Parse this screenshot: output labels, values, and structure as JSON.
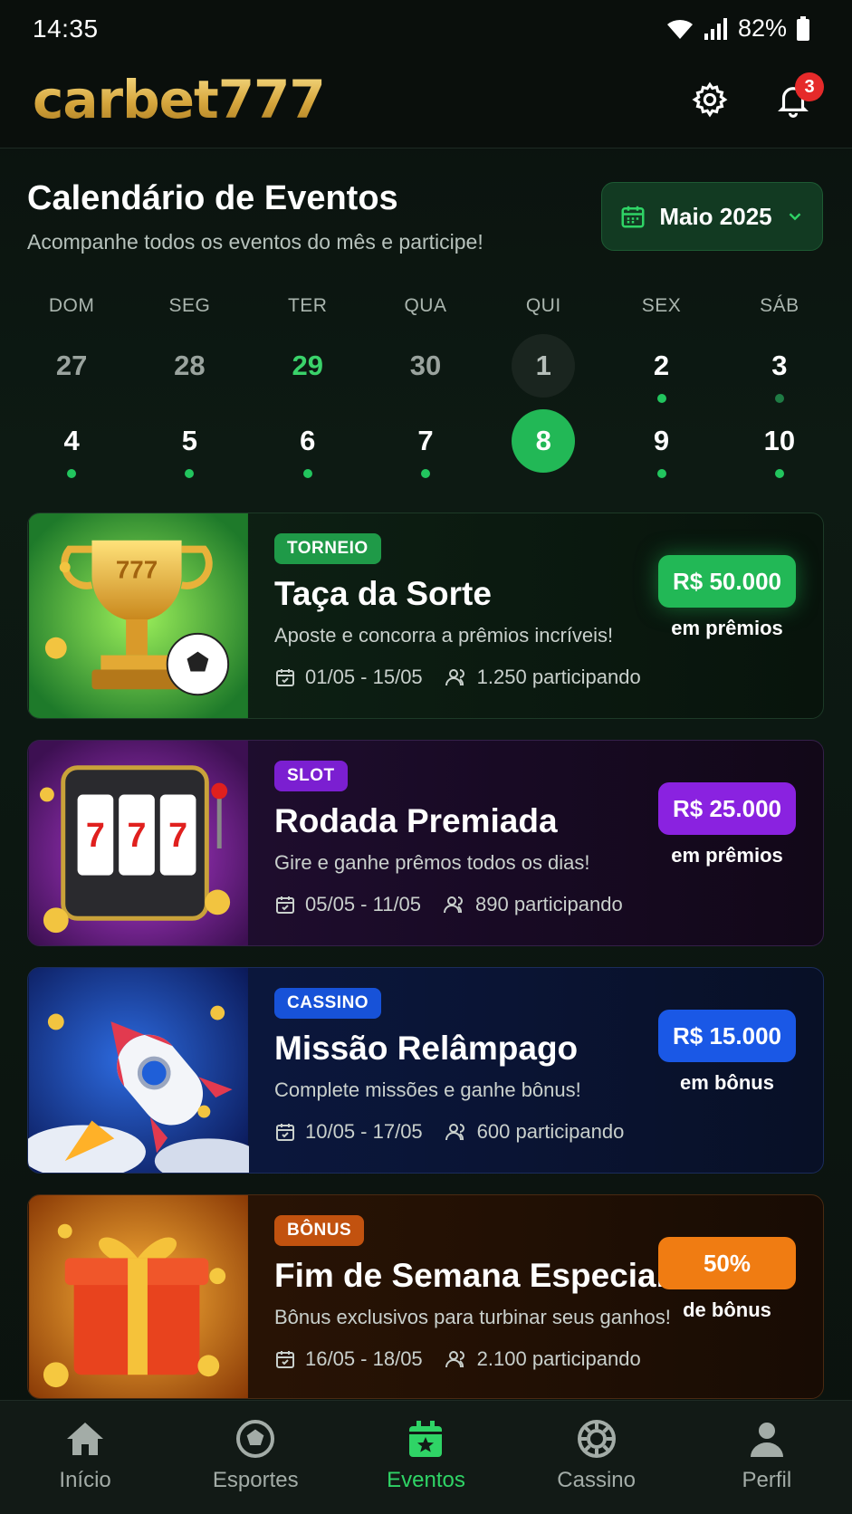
{
  "status_bar": {
    "time": "14:35",
    "battery": "82%"
  },
  "header": {
    "logo": "carbet777",
    "notifications_count": "3"
  },
  "calendar": {
    "title": "Calendário de Eventos",
    "subtitle": "Acompanhe todos os eventos do mês e participe!",
    "month_label": "Maio 2025",
    "weekdays": [
      "DOM",
      "SEG",
      "TER",
      "QUA",
      "QUI",
      "SEX",
      "SÁB"
    ],
    "week1": [
      "27",
      "28",
      "29",
      "30",
      "1",
      "2",
      "3"
    ],
    "week2": [
      "4",
      "5",
      "6",
      "7",
      "8",
      "9",
      "10"
    ]
  },
  "events": [
    {
      "tag": "TORNEIO",
      "title": "Taça da Sorte",
      "description": "Aposte e concorra a prêmios incríveis!",
      "dates": "01/05 - 15/05",
      "participants": "1.250 participando",
      "prize": "R$ 50.000",
      "prize_caption": "em prêmios",
      "art_icon": "trophy-soccer-art",
      "colors": {
        "tag": "#1f9a48",
        "pill": "#22b856"
      }
    },
    {
      "tag": "SLOT",
      "title": "Rodada Premiada",
      "description": "Gire e ganhe prêmos todos os dias!",
      "dates": "05/05 - 11/05",
      "participants": "890 participando",
      "prize": "R$ 25.000",
      "prize_caption": "em prêmios",
      "art_icon": "slot-machine-art",
      "colors": {
        "tag": "#7b1fd1",
        "pill": "#8a22e0"
      }
    },
    {
      "tag": "CASSINO",
      "title": "Missão Relâmpago",
      "description": "Complete missões e ganhe bônus!",
      "dates": "10/05 - 17/05",
      "participants": "600 participando",
      "prize": "R$ 15.000",
      "prize_caption": "em bônus",
      "art_icon": "rocket-art",
      "colors": {
        "tag": "#1752d8",
        "pill": "#1a58e6"
      }
    },
    {
      "tag": "BÔNUS",
      "title": "Fim de Semana Especial",
      "description": "Bônus exclusivos para turbinar seus ganhos!",
      "dates": "16/05 - 18/05",
      "participants": "2.100 participando",
      "prize": "50%",
      "prize_caption": "de bônus",
      "art_icon": "gift-box-art",
      "colors": {
        "tag": "#c2520f",
        "pill": "#f07c12"
      }
    }
  ],
  "bottom_nav": {
    "items": [
      "Início",
      "Esportes",
      "Eventos",
      "Cassino",
      "Perfil"
    ],
    "active": "Eventos"
  },
  "colors": {
    "accent": "#22b856",
    "background": "#0b120e"
  }
}
